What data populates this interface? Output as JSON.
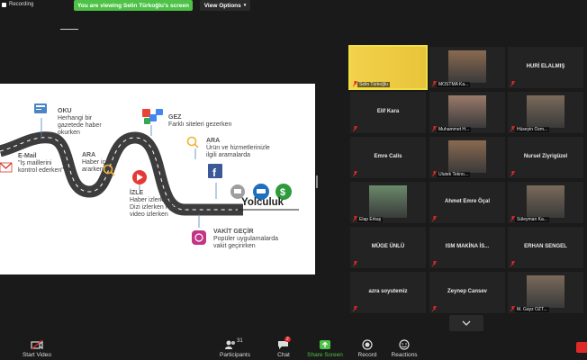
{
  "topbar": {
    "recording": "Recording",
    "viewing_banner": "You are viewing Selin Türkoğlu's screen",
    "view_options": "View Options"
  },
  "slide": {
    "oku_title": "OKU",
    "oku_text": "Herhangi bir gazetede haber okurken",
    "gez_title": "GEZ",
    "gez_text": "Farklı siteleri gezerken",
    "email_title": "E-Mail",
    "email_text": "\"İş maillerini kontrol ederken\"",
    "ara1_title": "ARA",
    "ara1_text": "Haber içeriği ararken",
    "ara2_title": "ARA",
    "ara2_text": "Ürün ve hizmetlerinizle ilgili aramalarda",
    "izle_title": "İZLE",
    "izle_text": "Haber izlerken Dizi izlerken Kısa video izlerken",
    "vakit_title": "VAKİT GEÇİR",
    "vakit_text": "Popüler uygulamalarda vakit geçirirken",
    "journey": "Yolculuk"
  },
  "participants": [
    {
      "name": "Selin Türkoğlu",
      "type": "video",
      "active": true
    },
    {
      "name": "MOSTMA Ka...",
      "type": "video",
      "active": false
    },
    {
      "name": "HURİ ELALMIŞ",
      "type": "name",
      "active": false
    },
    {
      "name": "Elif Kara",
      "type": "name",
      "active": false
    },
    {
      "name": "Muhammet H...",
      "type": "video",
      "active": false
    },
    {
      "name": "Hüseyin Özm...",
      "type": "video",
      "active": false
    },
    {
      "name": "Emre Calis",
      "type": "name",
      "active": false
    },
    {
      "name": "Ulutek Tekno...",
      "type": "video",
      "active": false
    },
    {
      "name": "Nursel Ziyrigüzel",
      "type": "name",
      "active": false
    },
    {
      "name": "Elap Erkaş",
      "type": "video",
      "active": false
    },
    {
      "name": "Ahmet Emre Öçal",
      "type": "name",
      "active": false
    },
    {
      "name": "Süleyman Ka...",
      "type": "video",
      "active": false
    },
    {
      "name": "MÜGE ÜNLÜ",
      "type": "name",
      "active": false
    },
    {
      "name": "ISM MAKİNA İS...",
      "type": "name",
      "active": false
    },
    {
      "name": "ERHAN SENGEL",
      "type": "name",
      "active": false
    },
    {
      "name": "azra soyutemiz",
      "type": "name",
      "active": false
    },
    {
      "name": "Zeynep Cansev",
      "type": "name",
      "active": false
    },
    {
      "name": "M. Gayz ÖZT...",
      "type": "video",
      "active": false
    }
  ],
  "toolbar": {
    "start_video": "Start Video",
    "participants": "Participants",
    "participants_count": "31",
    "chat": "Chat",
    "chat_badge": "2",
    "share_screen": "Share Screen",
    "record": "Record",
    "reactions": "Reactions"
  },
  "colors": {
    "share_green": "#4dc247",
    "active_speaker": "#f0e046",
    "muted_red": "#e02828"
  }
}
